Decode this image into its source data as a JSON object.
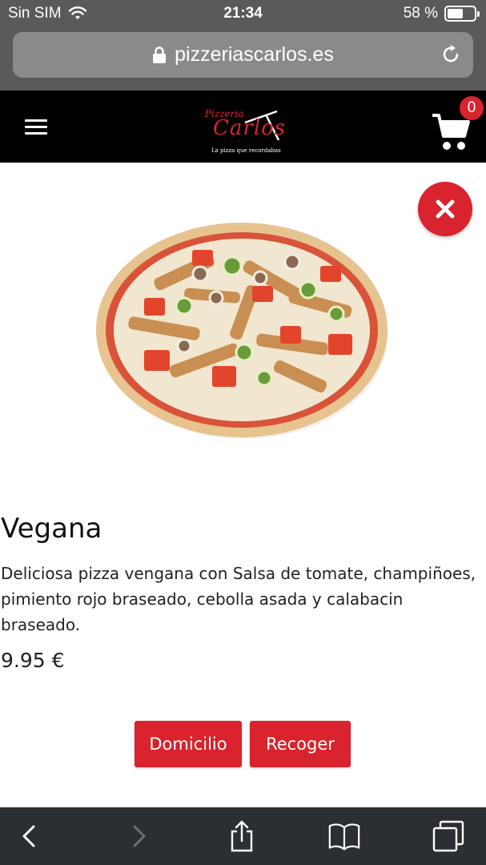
{
  "status_bar": {
    "carrier": "Sin SIM",
    "time": "21:34",
    "battery_text": "58 %",
    "battery_level": 0.58
  },
  "browser": {
    "url": "pizzeriascarlos.es"
  },
  "header": {
    "logo_small": "Pizzeria",
    "logo_big": "Carlos",
    "logo_tagline": "La pizza que recordabas",
    "cart_count": "0"
  },
  "product": {
    "name": "Vegana",
    "description": "Deliciosa pizza vengana con Salsa de tomate, champiñoes, pimiento rojo braseado, cebolla asada y calabacin braseado.",
    "price": "9.95 €"
  },
  "actions": {
    "delivery_label": "Domicilio",
    "pickup_label": "Recoger"
  },
  "colors": {
    "brand_red": "#d9232e",
    "header_bg": "#000000",
    "toolbar_bg": "#2b2f33"
  },
  "icons": {
    "menu": "hamburger-menu-icon",
    "cart": "shopping-cart-icon",
    "close": "close-icon",
    "lock": "lock-icon",
    "reload": "reload-icon"
  }
}
